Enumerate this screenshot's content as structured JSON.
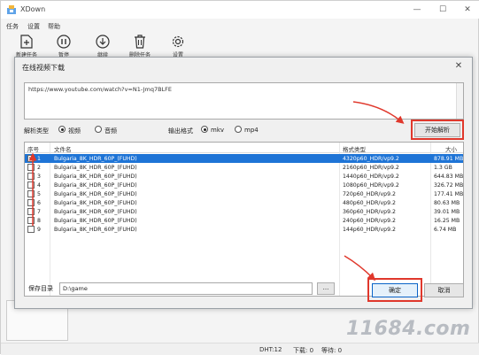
{
  "app": {
    "title": "XDown"
  },
  "menu": [
    "任务",
    "设置",
    "帮助"
  ],
  "toolbar": [
    {
      "label": "新建任务",
      "icon": "new-task-icon"
    },
    {
      "label": "暂停",
      "icon": "pause-icon"
    },
    {
      "label": "继续",
      "icon": "download-icon"
    },
    {
      "label": "删除任务",
      "icon": "delete-icon"
    },
    {
      "label": "设置",
      "icon": "gear-icon"
    }
  ],
  "dialog": {
    "title": "在线视频下载",
    "url": "https://www.youtube.com/watch?v=N1-Jmq7BLFE",
    "parse_type_label": "解析类型",
    "parse_types": [
      {
        "label": "视频",
        "selected": true
      },
      {
        "label": "音频",
        "selected": false
      }
    ],
    "output_format_label": "输出格式",
    "output_formats": [
      {
        "label": "mkv",
        "selected": true
      },
      {
        "label": "mp4",
        "selected": false
      }
    ],
    "parse_button": "开始解析",
    "columns": {
      "num": "序号",
      "name": "文件名",
      "format": "格式类型",
      "size": "大小"
    },
    "rows": [
      {
        "num": "1",
        "name": "Bulgaria_8K_HDR_60P_(FUHD)",
        "format": "4320p60_HDR/vp9.2",
        "size": "878.91 MB",
        "checked": true,
        "selected": true
      },
      {
        "num": "2",
        "name": "Bulgaria_8K_HDR_60P_(FUHD)",
        "format": "2160p60_HDR/vp9.2",
        "size": "1.3 GB",
        "checked": false,
        "selected": false
      },
      {
        "num": "3",
        "name": "Bulgaria_8K_HDR_60P_(FUHD)",
        "format": "1440p60_HDR/vp9.2",
        "size": "644.83 MB",
        "checked": false,
        "selected": false
      },
      {
        "num": "4",
        "name": "Bulgaria_8K_HDR_60P_(FUHD)",
        "format": "1080p60_HDR/vp9.2",
        "size": "326.72 MB",
        "checked": false,
        "selected": false
      },
      {
        "num": "5",
        "name": "Bulgaria_8K_HDR_60P_(FUHD)",
        "format": "720p60_HDR/vp9.2",
        "size": "177.41 MB",
        "checked": false,
        "selected": false
      },
      {
        "num": "6",
        "name": "Bulgaria_8K_HDR_60P_(FUHD)",
        "format": "480p60_HDR/vp9.2",
        "size": "80.63 MB",
        "checked": false,
        "selected": false
      },
      {
        "num": "7",
        "name": "Bulgaria_8K_HDR_60P_(FUHD)",
        "format": "360p60_HDR/vp9.2",
        "size": "39.01 MB",
        "checked": false,
        "selected": false
      },
      {
        "num": "8",
        "name": "Bulgaria_8K_HDR_60P_(FUHD)",
        "format": "240p60_HDR/vp9.2",
        "size": "16.25 MB",
        "checked": false,
        "selected": false
      },
      {
        "num": "9",
        "name": "Bulgaria_8K_HDR_60P_(FUHD)",
        "format": "144p60_HDR/vp9.2",
        "size": "6.74 MB",
        "checked": false,
        "selected": false
      }
    ],
    "save_dir_label": "保存目录",
    "save_dir_value": "D:\\game",
    "browse_button": "...",
    "ok_button": "确定",
    "cancel_button": "取消"
  },
  "status": {
    "dht": "DHT:12",
    "downloading": "下载: 0",
    "waiting": "等待: 0"
  },
  "watermark": {
    "text": "11684.com"
  },
  "colors": {
    "selection": "#1e74d6",
    "annotation": "#e0382c"
  }
}
